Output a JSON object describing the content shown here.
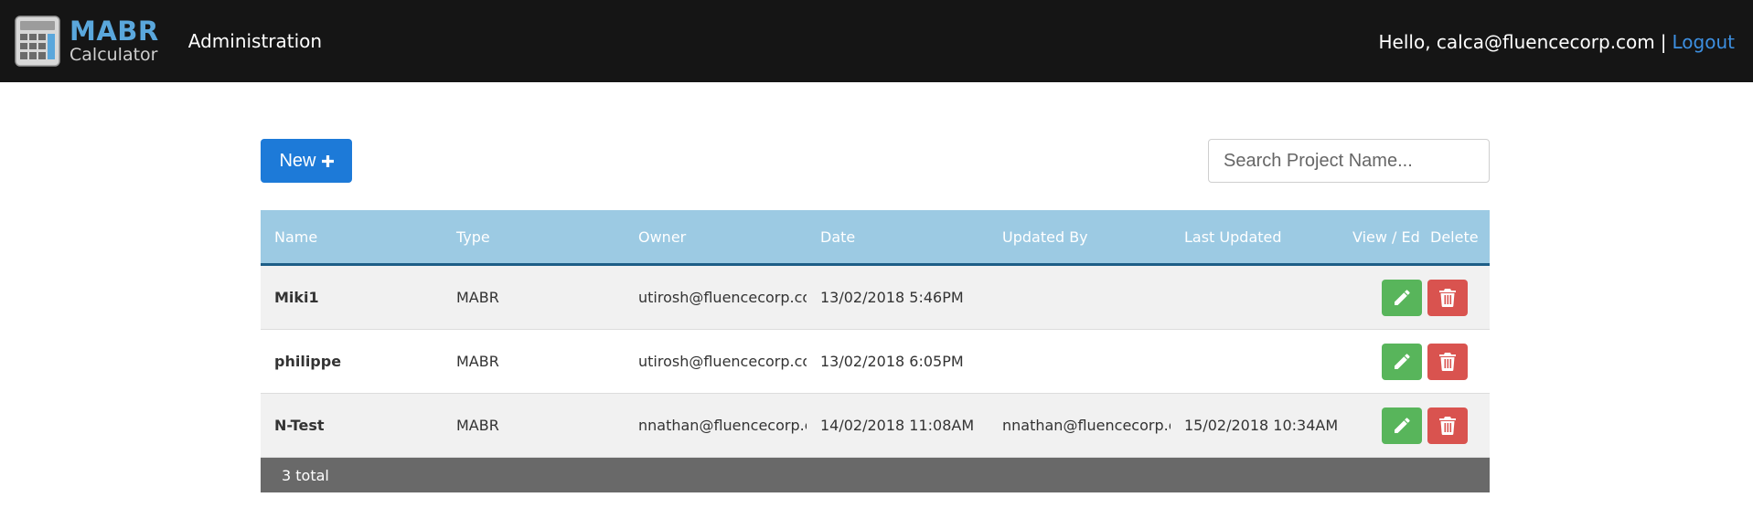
{
  "brand": {
    "main": "MABR",
    "sub": "Calculator"
  },
  "nav": {
    "admin": "Administration",
    "greeting": "Hello, calca@fluencecorp.com",
    "separator": "|",
    "logout": "Logout"
  },
  "toolbar": {
    "new_label": "New",
    "search_placeholder": "Search Project Name..."
  },
  "table": {
    "headers": {
      "name": "Name",
      "type": "Type",
      "owner": "Owner",
      "date": "Date",
      "updated_by": "Updated By",
      "last_updated": "Last Updated",
      "view_edit": "View / Edit",
      "delete": "Delete"
    },
    "rows": [
      {
        "name": "Miki1",
        "type": "MABR",
        "owner": "utirosh@fluencecorp.com",
        "date": "13/02/2018 5:46PM",
        "updated_by": "",
        "last_updated": ""
      },
      {
        "name": "philippe",
        "type": "MABR",
        "owner": "utirosh@fluencecorp.com",
        "date": "13/02/2018 6:05PM",
        "updated_by": "",
        "last_updated": ""
      },
      {
        "name": "N-Test",
        "type": "MABR",
        "owner": "nnathan@fluencecorp.com",
        "date": "14/02/2018 11:08AM",
        "updated_by": "nnathan@fluencecorp.com",
        "last_updated": "15/02/2018 10:34AM"
      }
    ],
    "footer": "3 total"
  },
  "icons": {
    "logo": "calculator-icon",
    "new": "plus-icon",
    "edit": "pencil-icon",
    "delete": "trash-icon"
  },
  "colors": {
    "navbar": "#151515",
    "brand": "#5aa7dc",
    "primary": "#1d7ad8",
    "header": "#9ccae3",
    "edit": "#58b55b",
    "delete": "#d9534f",
    "footer": "#696969",
    "link": "#3d8fe0"
  }
}
